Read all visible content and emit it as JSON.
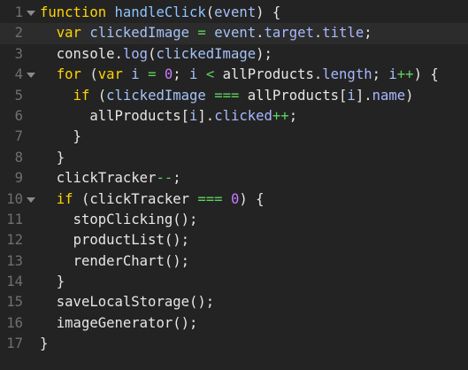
{
  "editor": {
    "lines": [
      {
        "num": "1",
        "fold": true,
        "active": false,
        "tokens": [
          {
            "t": "function",
            "c": "kw"
          },
          {
            "t": " ",
            "c": "tx"
          },
          {
            "t": "handleClick",
            "c": "fn"
          },
          {
            "t": "(",
            "c": "pn"
          },
          {
            "t": "event",
            "c": "id"
          },
          {
            "t": ") {",
            "c": "pn"
          }
        ]
      },
      {
        "num": "2",
        "fold": false,
        "active": true,
        "tokens": [
          {
            "t": "  ",
            "c": "tx"
          },
          {
            "t": "var",
            "c": "kw"
          },
          {
            "t": " ",
            "c": "tx"
          },
          {
            "t": "clickedImage",
            "c": "id"
          },
          {
            "t": " ",
            "c": "tx"
          },
          {
            "t": "=",
            "c": "op"
          },
          {
            "t": " ",
            "c": "tx"
          },
          {
            "t": "event",
            "c": "id"
          },
          {
            "t": ".",
            "c": "pn"
          },
          {
            "t": "target",
            "c": "pr"
          },
          {
            "t": ".",
            "c": "pn"
          },
          {
            "t": "title",
            "c": "pr"
          },
          {
            "t": ";",
            "c": "pn"
          }
        ]
      },
      {
        "num": "3",
        "fold": false,
        "active": false,
        "tokens": [
          {
            "t": "  ",
            "c": "tx"
          },
          {
            "t": "console",
            "c": "tx"
          },
          {
            "t": ".",
            "c": "pn"
          },
          {
            "t": "log",
            "c": "pr"
          },
          {
            "t": "(",
            "c": "pn"
          },
          {
            "t": "clickedImage",
            "c": "id"
          },
          {
            "t": ");",
            "c": "pn"
          }
        ]
      },
      {
        "num": "4",
        "fold": true,
        "active": false,
        "tokens": [
          {
            "t": "  ",
            "c": "tx"
          },
          {
            "t": "for",
            "c": "kw"
          },
          {
            "t": " (",
            "c": "pn"
          },
          {
            "t": "var",
            "c": "kw"
          },
          {
            "t": " ",
            "c": "tx"
          },
          {
            "t": "i",
            "c": "id"
          },
          {
            "t": " ",
            "c": "tx"
          },
          {
            "t": "=",
            "c": "op"
          },
          {
            "t": " ",
            "c": "tx"
          },
          {
            "t": "0",
            "c": "nm"
          },
          {
            "t": "; ",
            "c": "pn"
          },
          {
            "t": "i",
            "c": "id"
          },
          {
            "t": " ",
            "c": "tx"
          },
          {
            "t": "<",
            "c": "op"
          },
          {
            "t": " ",
            "c": "tx"
          },
          {
            "t": "allProducts",
            "c": "tx"
          },
          {
            "t": ".",
            "c": "pn"
          },
          {
            "t": "length",
            "c": "pr"
          },
          {
            "t": "; ",
            "c": "pn"
          },
          {
            "t": "i",
            "c": "id"
          },
          {
            "t": "++",
            "c": "op"
          },
          {
            "t": ") {",
            "c": "pn"
          }
        ]
      },
      {
        "num": "5",
        "fold": false,
        "active": false,
        "tokens": [
          {
            "t": "    ",
            "c": "tx"
          },
          {
            "t": "if",
            "c": "kw"
          },
          {
            "t": " (",
            "c": "pn"
          },
          {
            "t": "clickedImage",
            "c": "id"
          },
          {
            "t": " ",
            "c": "tx"
          },
          {
            "t": "===",
            "c": "op"
          },
          {
            "t": " ",
            "c": "tx"
          },
          {
            "t": "allProducts",
            "c": "tx"
          },
          {
            "t": "[",
            "c": "pn"
          },
          {
            "t": "i",
            "c": "id"
          },
          {
            "t": "].",
            "c": "pn"
          },
          {
            "t": "name",
            "c": "pr"
          },
          {
            "t": ")",
            "c": "pn"
          }
        ]
      },
      {
        "num": "6",
        "fold": false,
        "active": false,
        "tokens": [
          {
            "t": "      ",
            "c": "tx"
          },
          {
            "t": "allProducts",
            "c": "tx"
          },
          {
            "t": "[",
            "c": "pn"
          },
          {
            "t": "i",
            "c": "id"
          },
          {
            "t": "].",
            "c": "pn"
          },
          {
            "t": "clicked",
            "c": "pr"
          },
          {
            "t": "++",
            "c": "op"
          },
          {
            "t": ";",
            "c": "pn"
          }
        ]
      },
      {
        "num": "7",
        "fold": false,
        "active": false,
        "tokens": [
          {
            "t": "    }",
            "c": "pn"
          }
        ]
      },
      {
        "num": "8",
        "fold": false,
        "active": false,
        "tokens": [
          {
            "t": "  }",
            "c": "pn"
          }
        ]
      },
      {
        "num": "9",
        "fold": false,
        "active": false,
        "tokens": [
          {
            "t": "  ",
            "c": "tx"
          },
          {
            "t": "clickTracker",
            "c": "tx"
          },
          {
            "t": "--",
            "c": "op"
          },
          {
            "t": ";",
            "c": "pn"
          }
        ]
      },
      {
        "num": "10",
        "fold": true,
        "active": false,
        "tokens": [
          {
            "t": "  ",
            "c": "tx"
          },
          {
            "t": "if",
            "c": "kw"
          },
          {
            "t": " (",
            "c": "pn"
          },
          {
            "t": "clickTracker",
            "c": "tx"
          },
          {
            "t": " ",
            "c": "tx"
          },
          {
            "t": "===",
            "c": "op"
          },
          {
            "t": " ",
            "c": "tx"
          },
          {
            "t": "0",
            "c": "nm"
          },
          {
            "t": ") {",
            "c": "pn"
          }
        ]
      },
      {
        "num": "11",
        "fold": false,
        "active": false,
        "tokens": [
          {
            "t": "    ",
            "c": "tx"
          },
          {
            "t": "stopClicking",
            "c": "tx"
          },
          {
            "t": "();",
            "c": "pn"
          }
        ]
      },
      {
        "num": "12",
        "fold": false,
        "active": false,
        "tokens": [
          {
            "t": "    ",
            "c": "tx"
          },
          {
            "t": "productList",
            "c": "tx"
          },
          {
            "t": "();",
            "c": "pn"
          }
        ]
      },
      {
        "num": "13",
        "fold": false,
        "active": false,
        "tokens": [
          {
            "t": "    ",
            "c": "tx"
          },
          {
            "t": "renderChart",
            "c": "tx"
          },
          {
            "t": "();",
            "c": "pn"
          }
        ]
      },
      {
        "num": "14",
        "fold": false,
        "active": false,
        "tokens": [
          {
            "t": "  }",
            "c": "pn"
          }
        ]
      },
      {
        "num": "15",
        "fold": false,
        "active": false,
        "tokens": [
          {
            "t": "  ",
            "c": "tx"
          },
          {
            "t": "saveLocalStorage",
            "c": "tx"
          },
          {
            "t": "();",
            "c": "pn"
          }
        ]
      },
      {
        "num": "16",
        "fold": false,
        "active": false,
        "tokens": [
          {
            "t": "  ",
            "c": "tx"
          },
          {
            "t": "imageGenerator",
            "c": "tx"
          },
          {
            "t": "();",
            "c": "pn"
          }
        ]
      },
      {
        "num": "17",
        "fold": false,
        "active": false,
        "tokens": [
          {
            "t": "}",
            "c": "pn"
          }
        ]
      }
    ]
  }
}
